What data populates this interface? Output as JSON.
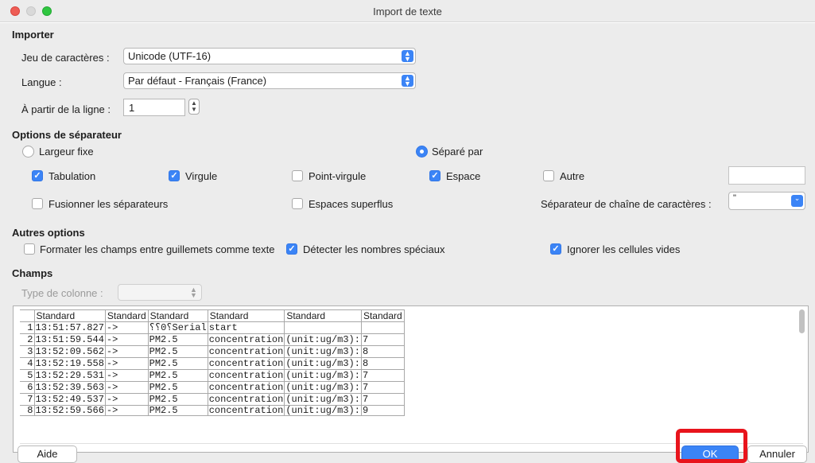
{
  "window": {
    "title": "Import de texte"
  },
  "import_section": {
    "heading": "Importer",
    "charset_label": "Jeu de caractères :",
    "charset_value": "Unicode (UTF-16)",
    "language_label": "Langue :",
    "language_value": "Par défaut - Français (France)",
    "from_line_label": "À partir de la ligne :",
    "from_line_value": "1"
  },
  "separator_options": {
    "heading": "Options de séparateur",
    "fixed_width_label": "Largeur fixe",
    "separated_by_label": "Séparé par",
    "tab_label": "Tabulation",
    "comma_label": "Virgule",
    "semicolon_label": "Point-virgule",
    "space_label": "Espace",
    "other_label": "Autre",
    "merge_label": "Fusionner les séparateurs",
    "trim_label": "Espaces superflus",
    "string_delim_label": "Séparateur de chaîne de caractères :",
    "string_delim_value": "\""
  },
  "other_options": {
    "heading": "Autres options",
    "quoted_as_text_label": "Formater les champs entre guillemets comme texte",
    "detect_special_label": "Détecter les nombres spéciaux",
    "skip_empty_label": "Ignorer les cellules vides"
  },
  "fields": {
    "heading": "Champs",
    "column_type_label": "Type de colonne :",
    "column_type_value": "",
    "headers": [
      "Standard",
      "Standard",
      "Standard",
      "Standard",
      "Standard",
      "Standard"
    ],
    "rows": [
      [
        "1",
        "13:51:57.827",
        "->",
        "⸮⸮0⸮Serial",
        "start",
        "",
        ""
      ],
      [
        "2",
        "13:51:59.544",
        "->",
        "PM2.5",
        "concentration",
        "(unit:ug/m3):",
        "7"
      ],
      [
        "3",
        "13:52:09.562",
        "->",
        "PM2.5",
        "concentration",
        "(unit:ug/m3):",
        "8"
      ],
      [
        "4",
        "13:52:19.558",
        "->",
        "PM2.5",
        "concentration",
        "(unit:ug/m3):",
        "8"
      ],
      [
        "5",
        "13:52:29.531",
        "->",
        "PM2.5",
        "concentration",
        "(unit:ug/m3):",
        "7"
      ],
      [
        "6",
        "13:52:39.563",
        "->",
        "PM2.5",
        "concentration",
        "(unit:ug/m3):",
        "7"
      ],
      [
        "7",
        "13:52:49.537",
        "->",
        "PM2.5",
        "concentration",
        "(unit:ug/m3):",
        "7"
      ],
      [
        "8",
        "13:52:59.566",
        "->",
        "PM2.5",
        "concentration",
        "(unit:ug/m3):",
        "9"
      ]
    ]
  },
  "buttons": {
    "help": "Aide",
    "ok": "OK",
    "cancel": "Annuler"
  },
  "colors": {
    "accent": "#3b84f6",
    "highlight": "#e8141c"
  }
}
